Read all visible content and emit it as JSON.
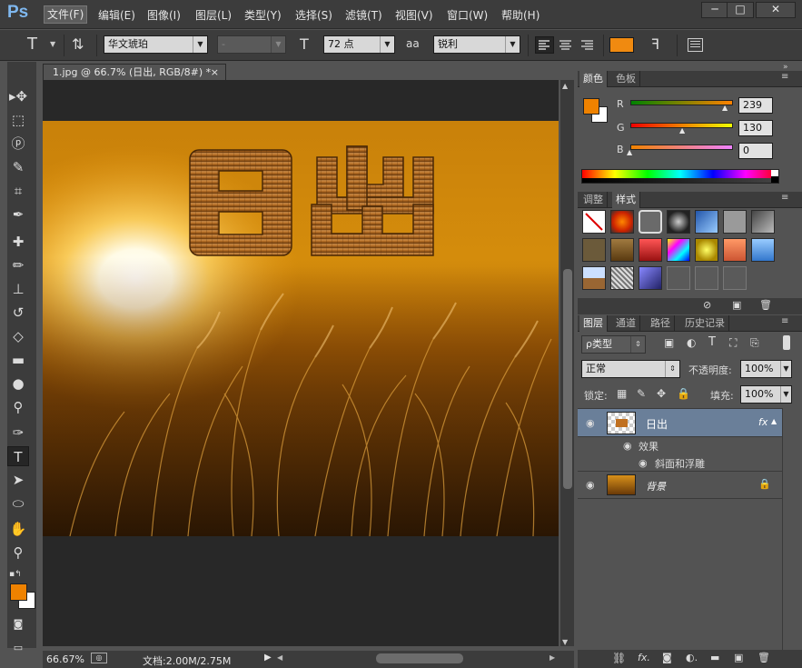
{
  "app": {
    "logo": "Ps"
  },
  "menu": [
    "文件(F)",
    "编辑(E)",
    "图像(I)",
    "图层(L)",
    "类型(Y)",
    "选择(S)",
    "滤镜(T)",
    "视图(V)",
    "窗口(W)",
    "帮助(H)"
  ],
  "window_controls": {
    "minimize": "─",
    "maximize": "□",
    "close": "✕"
  },
  "options": {
    "tool_icon": "T",
    "font_family": "华文琥珀",
    "font_style": "-",
    "font_size": "72 点",
    "aa_label": "aa",
    "antialias": "锐利",
    "text_color": "#f08a10"
  },
  "document": {
    "tab_title": "1.jpg @ 66.7% (日出, RGB/8#) *",
    "tab_close": "×",
    "headline_text": "日出"
  },
  "status": {
    "zoom": "66.67%",
    "doc_info": "文档:2.00M/2.75M"
  },
  "colors": {
    "foreground": "#ef8200",
    "background": "#ffffff",
    "tabs": [
      "颜色",
      "色板"
    ],
    "r_label": "R",
    "g_label": "G",
    "b_label": "B",
    "r": "239",
    "g": "130",
    "b": "0"
  },
  "styles": {
    "tabs": [
      "调整",
      "样式"
    ]
  },
  "layers": {
    "tabs": [
      "图层",
      "通道",
      "路径",
      "历史记录"
    ],
    "filter_kind": "ρ类型",
    "blend_mode": "正常",
    "opacity_label": "不透明度:",
    "opacity": "100%",
    "lock_label": "锁定:",
    "fill_label": "填充:",
    "fill": "100%",
    "items": [
      {
        "name": "日出",
        "fx": "fx"
      },
      {
        "name": "效果"
      },
      {
        "name": "斜面和浮雕"
      },
      {
        "name": "背景"
      }
    ]
  }
}
